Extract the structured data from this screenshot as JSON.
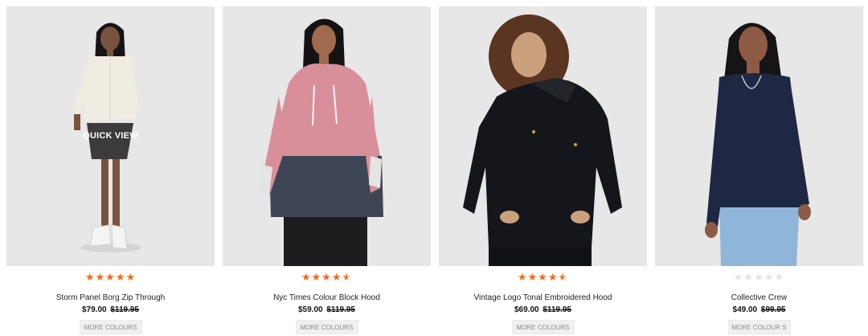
{
  "overlay": {
    "quick_view": "QUICK VIEW"
  },
  "products": [
    {
      "name": "Storm Panel Borg Zip Through",
      "price": "$79.00",
      "was_price": "$119.95",
      "rating": 5,
      "more_colours": "MORE COLOURS",
      "garment_colors": {
        "top": "#f1ece1",
        "bottom": "#3c3a3a"
      }
    },
    {
      "name": "Nyc Times Colour Block Hood",
      "price": "$59.00",
      "was_price": "$119.95",
      "rating": 4.5,
      "more_colours": "MORE COLOURS",
      "garment_colors": {
        "top": "#d98f9a",
        "bottom": "#3e4656"
      }
    },
    {
      "name": "Vintage Logo Tonal Embroidered Hood",
      "price": "$69.00",
      "was_price": "$119.95",
      "rating": 4.5,
      "more_colours": "MORE COLOURS",
      "garment_colors": {
        "top": "#15161c",
        "bottom": "#15161c"
      }
    },
    {
      "name": "Collective Crew",
      "price": "$49.00",
      "was_price": "$99.95",
      "rating": 0,
      "more_colours": "MORE COLOUR S",
      "garment_colors": {
        "top": "#1e2843",
        "bottom": "#8fb6d9"
      }
    }
  ]
}
